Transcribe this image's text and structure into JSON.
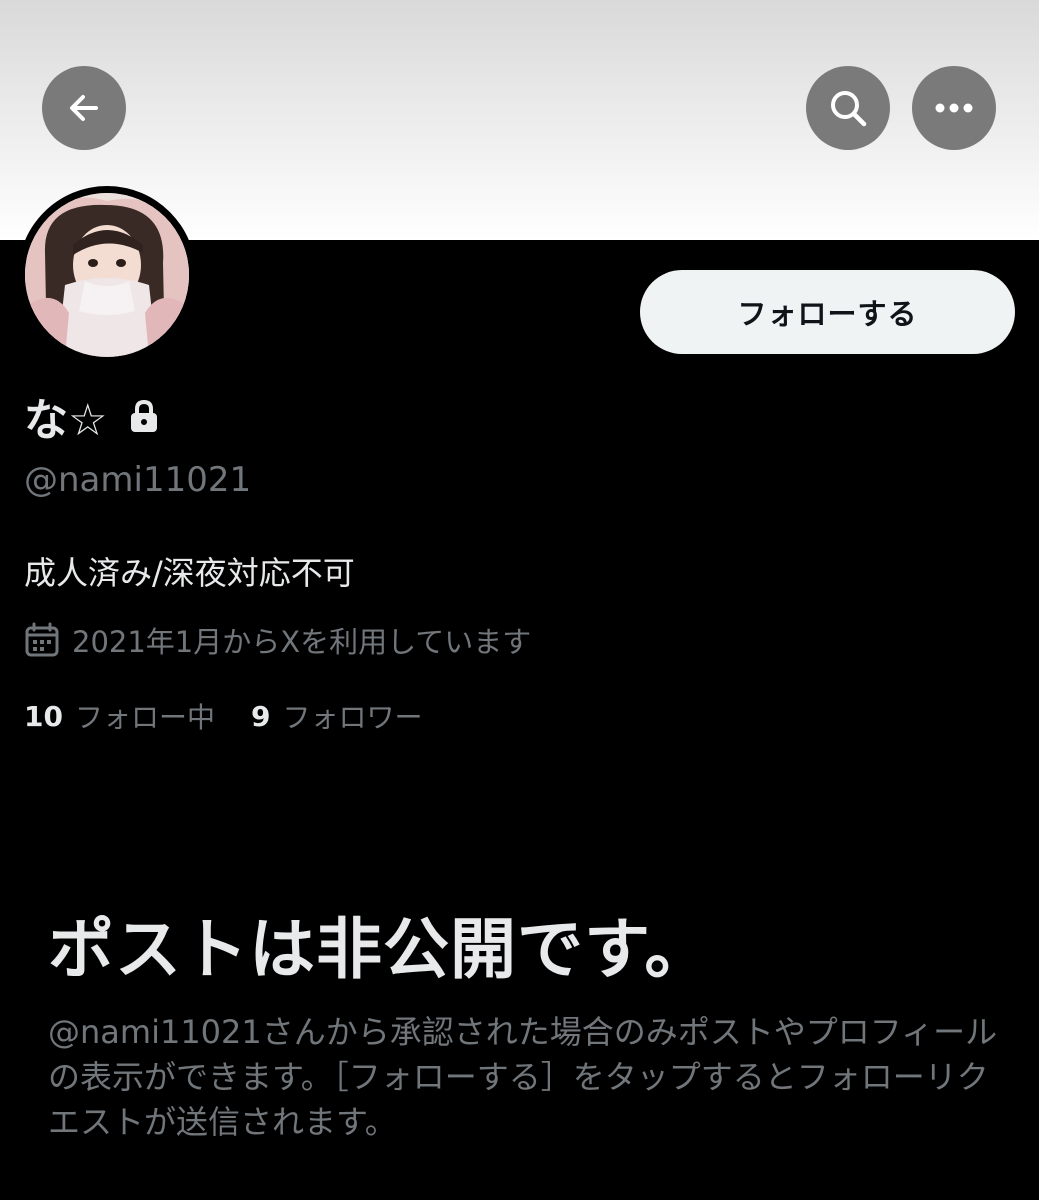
{
  "header": {
    "back_icon": "arrow-left-icon",
    "search_icon": "search-icon",
    "more_icon": "more-horizontal-icon",
    "button_bg": "#7a7a7a"
  },
  "profile": {
    "display_name": "な☆",
    "protected_icon": "lock-icon",
    "handle": "@nami11021",
    "bio": "成人済み/深夜対応不可",
    "joined_icon": "calendar-icon",
    "joined_text": "2021年1月からXを利用しています",
    "following_count": "10",
    "following_label": "フォロー中",
    "followers_count": "9",
    "followers_label": "フォロワー"
  },
  "follow_button": {
    "label": "フォローする"
  },
  "private_notice": {
    "title": "ポストは非公開です。",
    "description": "@nami11021さんから承認された場合のみポストやプロフィールの表示ができます。［フォローする］をタップするとフォローリクエストが送信されます。"
  },
  "colors": {
    "background": "#000000",
    "primary_text": "#e7e9ea",
    "secondary_text": "#71767b",
    "follow_button_bg": "#eff3f4"
  }
}
